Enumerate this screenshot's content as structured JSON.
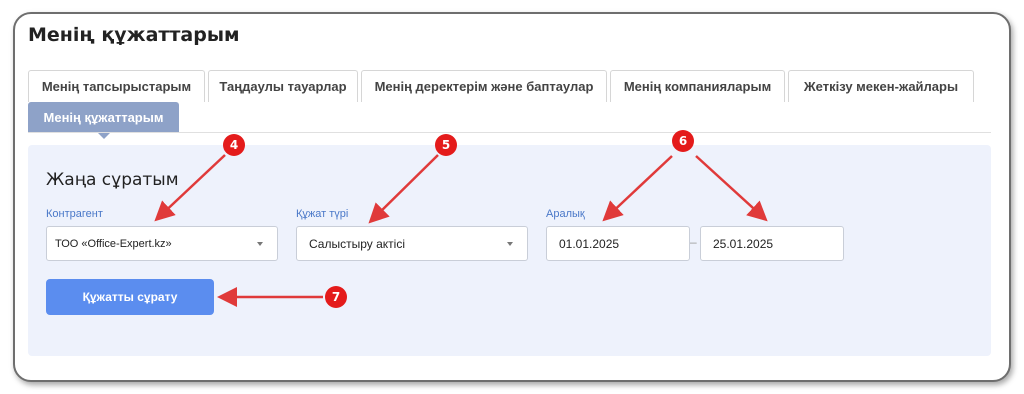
{
  "page": {
    "title": "Менің құжаттарым"
  },
  "tabs": [
    {
      "label": "Менің тапсырыстарым"
    },
    {
      "label": "Таңдаулы тауарлар"
    },
    {
      "label": "Менің деректерім және баптаулар"
    },
    {
      "label": "Менің компанияларым"
    },
    {
      "label": "Жеткізу мекен-жайлары"
    },
    {
      "label": "Менің құжаттарым",
      "active": true
    }
  ],
  "form": {
    "title": "Жаңа сұратым",
    "counterparty": {
      "label": "Контрагент",
      "value": "ТОО «Office-Expert.kz»"
    },
    "doc_type": {
      "label": "Құжат түрі",
      "value": "Салыстыру актісі"
    },
    "period": {
      "label": "Аралық",
      "from": "01.01.2025",
      "separator": "–",
      "to": "25.01.2025"
    },
    "submit_label": "Құжатты сұрату"
  },
  "annotations": [
    {
      "number": "4"
    },
    {
      "number": "5"
    },
    {
      "number": "6"
    },
    {
      "number": "7"
    }
  ],
  "colors": {
    "accent": "#5b8def",
    "active_tab": "#8ea2c8",
    "panel_bg": "#eef2fc",
    "callout": "#e41b1b",
    "label": "#4a78c8"
  }
}
